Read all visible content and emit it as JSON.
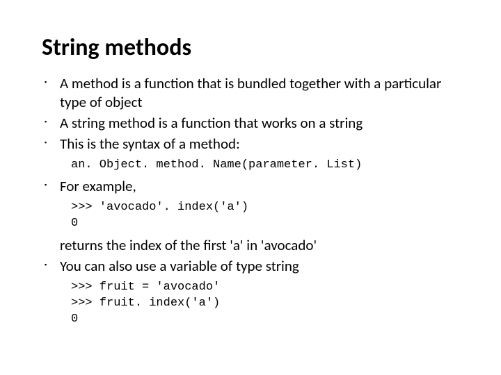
{
  "title": "String methods",
  "bullets": {
    "b1": "A method is a function that is bundled together with a particular type of object",
    "b2": "A string method is a function that works on a string",
    "b3": "This is the syntax of a method:",
    "b4": "For example,",
    "b5": "You can also use a variable of type string"
  },
  "code": {
    "syntax": "an. Object. method. Name(parameter. List)",
    "example1": ">>> 'avocado'. index('a')\n0",
    "example2": ">>> fruit = 'avocado'\n>>> fruit. index('a')\n0"
  },
  "returns_text": "returns the index of the first 'a' in 'avocado'"
}
